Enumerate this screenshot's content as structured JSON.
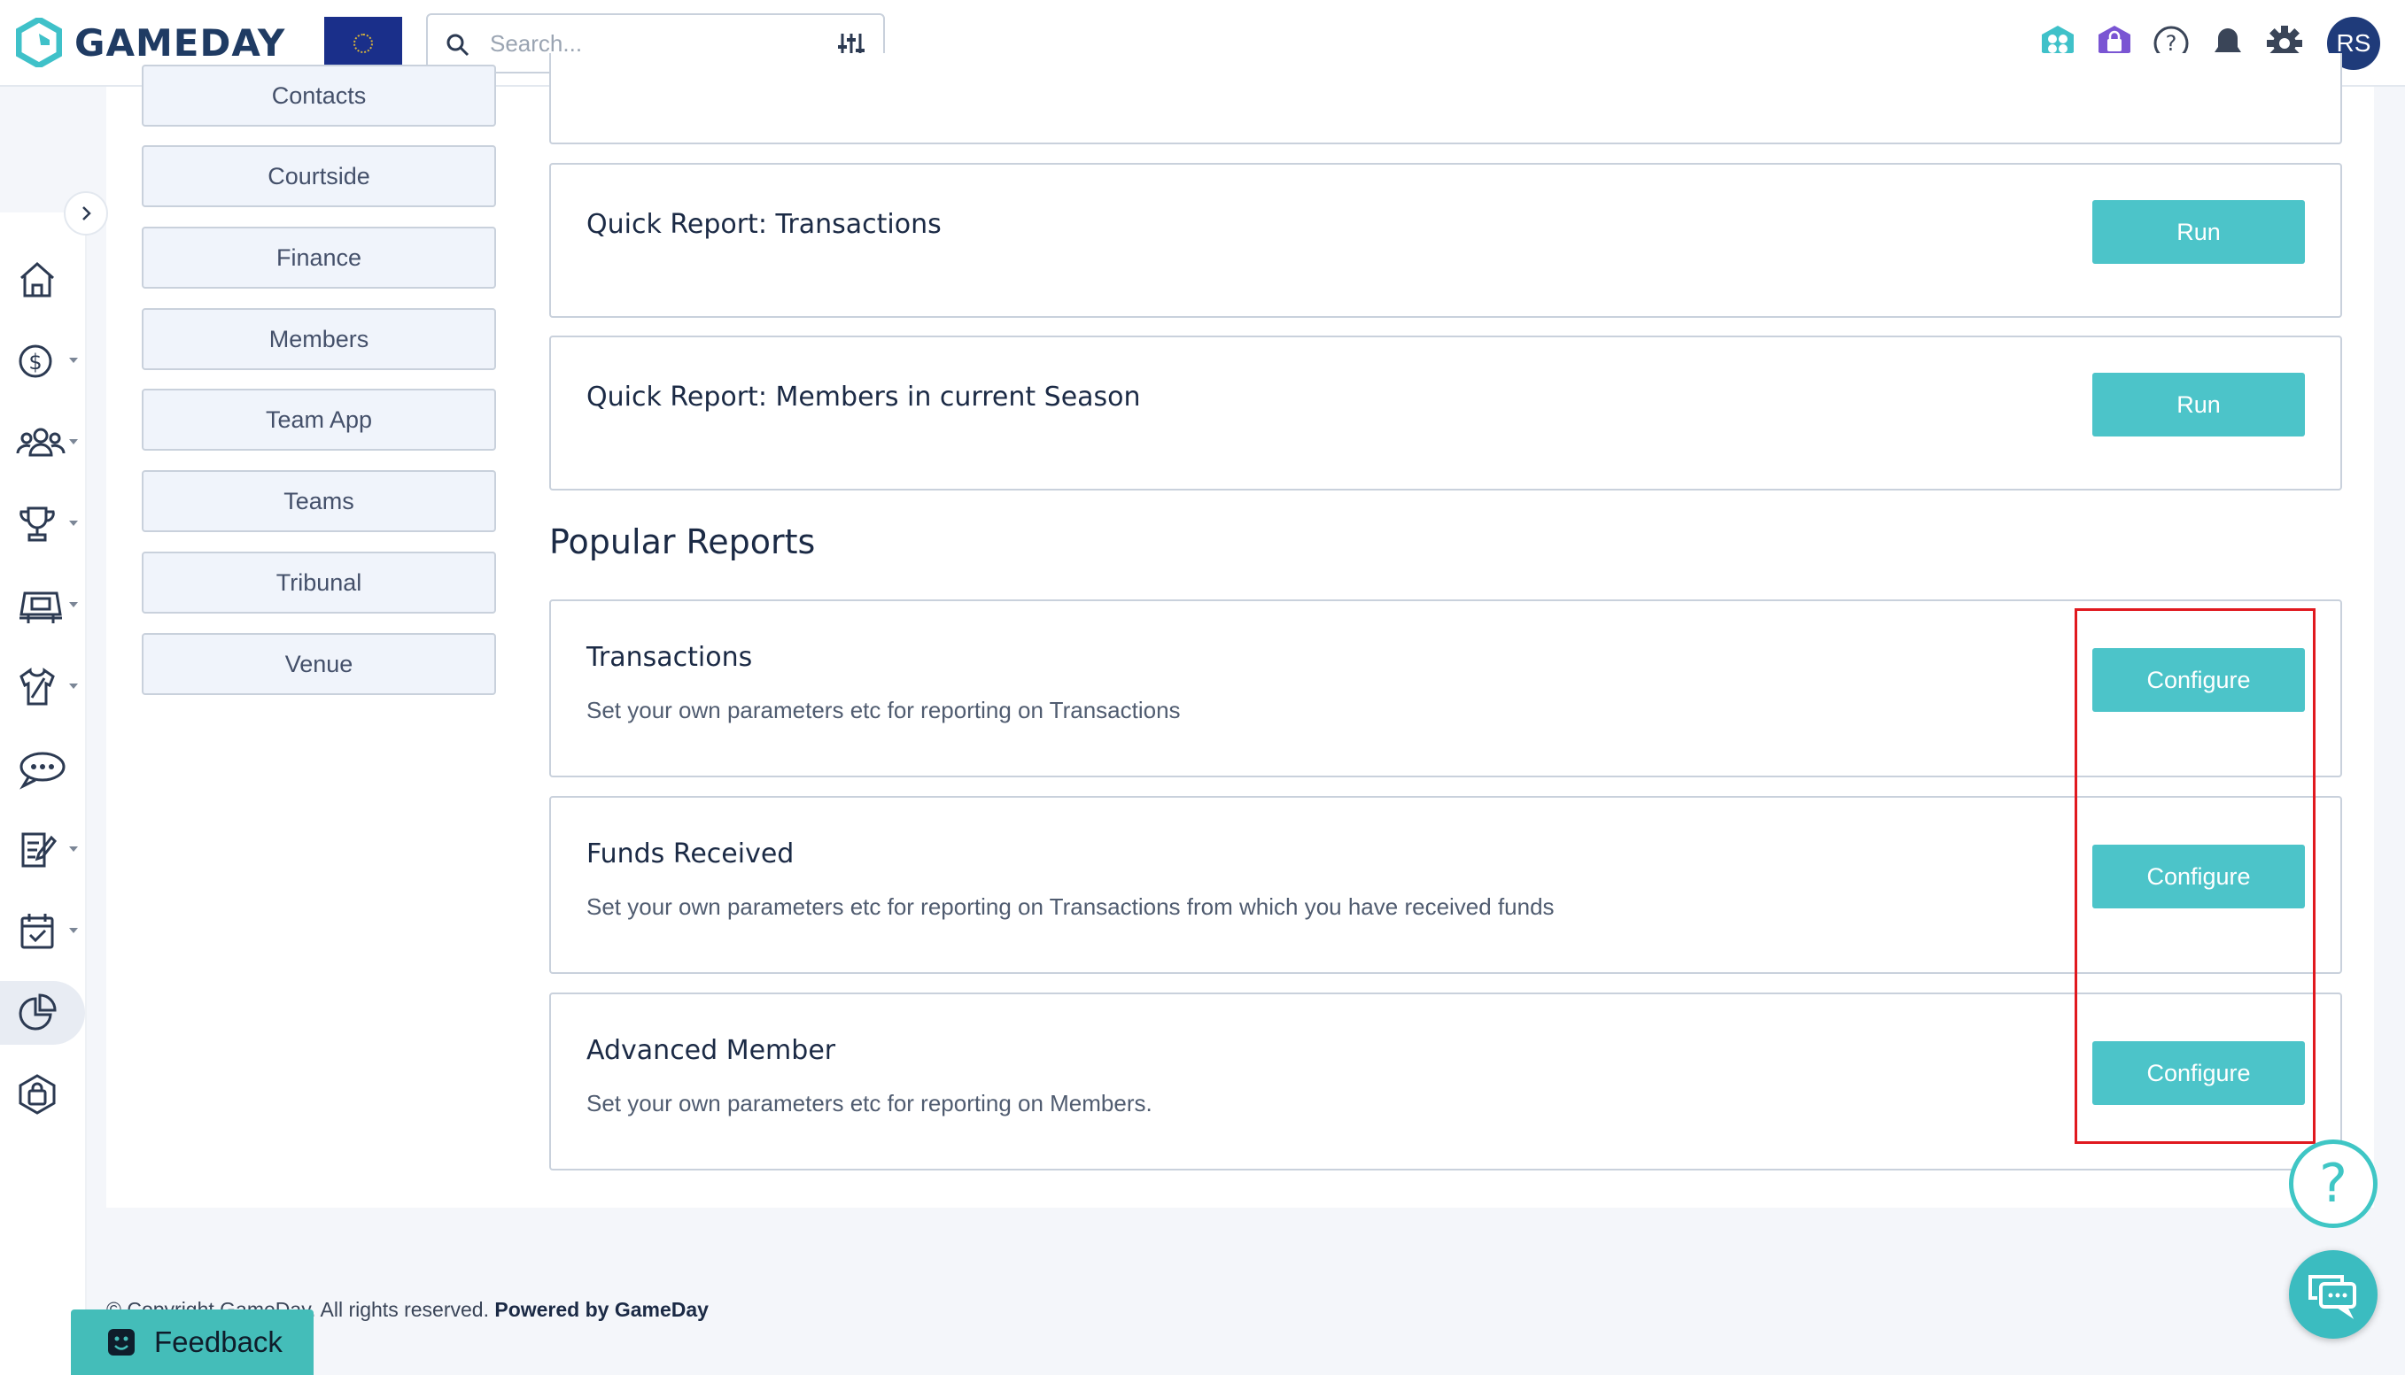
{
  "header": {
    "logo_text": "GAMEDAY",
    "search_placeholder": "Search...",
    "avatar_initials": "RS",
    "icons": [
      "apps-hex-icon",
      "shop-bag-icon",
      "help-icon",
      "bell-icon",
      "gear-icon"
    ]
  },
  "sidebar": {
    "items": [
      {
        "icon": "home-icon",
        "has_caret": false
      },
      {
        "icon": "dollar-icon",
        "has_caret": true
      },
      {
        "icon": "members-icon",
        "has_caret": true
      },
      {
        "icon": "trophy-icon",
        "has_caret": true
      },
      {
        "icon": "venue-icon",
        "has_caret": true
      },
      {
        "icon": "jersey-icon",
        "has_caret": true
      },
      {
        "icon": "chat-bubbles-icon",
        "has_caret": false
      },
      {
        "icon": "edit-form-icon",
        "has_caret": true
      },
      {
        "icon": "calendar-icon",
        "has_caret": true
      },
      {
        "icon": "reports-pie-icon",
        "has_caret": false,
        "active": true
      },
      {
        "icon": "shop-icon",
        "has_caret": false
      }
    ]
  },
  "categories": [
    "Contacts",
    "Courtside",
    "Finance",
    "Members",
    "Team App",
    "Teams",
    "Tribunal",
    "Venue"
  ],
  "quick_reports": [
    {
      "title": "Quick Report: Transactions",
      "button": "Run"
    },
    {
      "title": "Quick Report: Members in current Season",
      "button": "Run"
    }
  ],
  "popular_title": "Popular Reports",
  "popular_reports": [
    {
      "title": "Transactions",
      "description": "Set your own parameters etc for reporting on Transactions",
      "button": "Configure"
    },
    {
      "title": "Funds Received",
      "description": "Set your own parameters etc for reporting on Transactions from which you have received funds",
      "button": "Configure"
    },
    {
      "title": "Advanced Member",
      "description": "Set your own parameters etc for reporting on Members.",
      "button": "Configure"
    }
  ],
  "footer": {
    "copyright": "© Copyright GameDay. All rights reserved.",
    "powered_by": "Powered by GameDay"
  },
  "feedback_label": "Feedback",
  "colors": {
    "accent": "#4cc4c9",
    "brand": "#1f3b63",
    "highlight": "#e0191f",
    "border": "#c9d1dc"
  }
}
